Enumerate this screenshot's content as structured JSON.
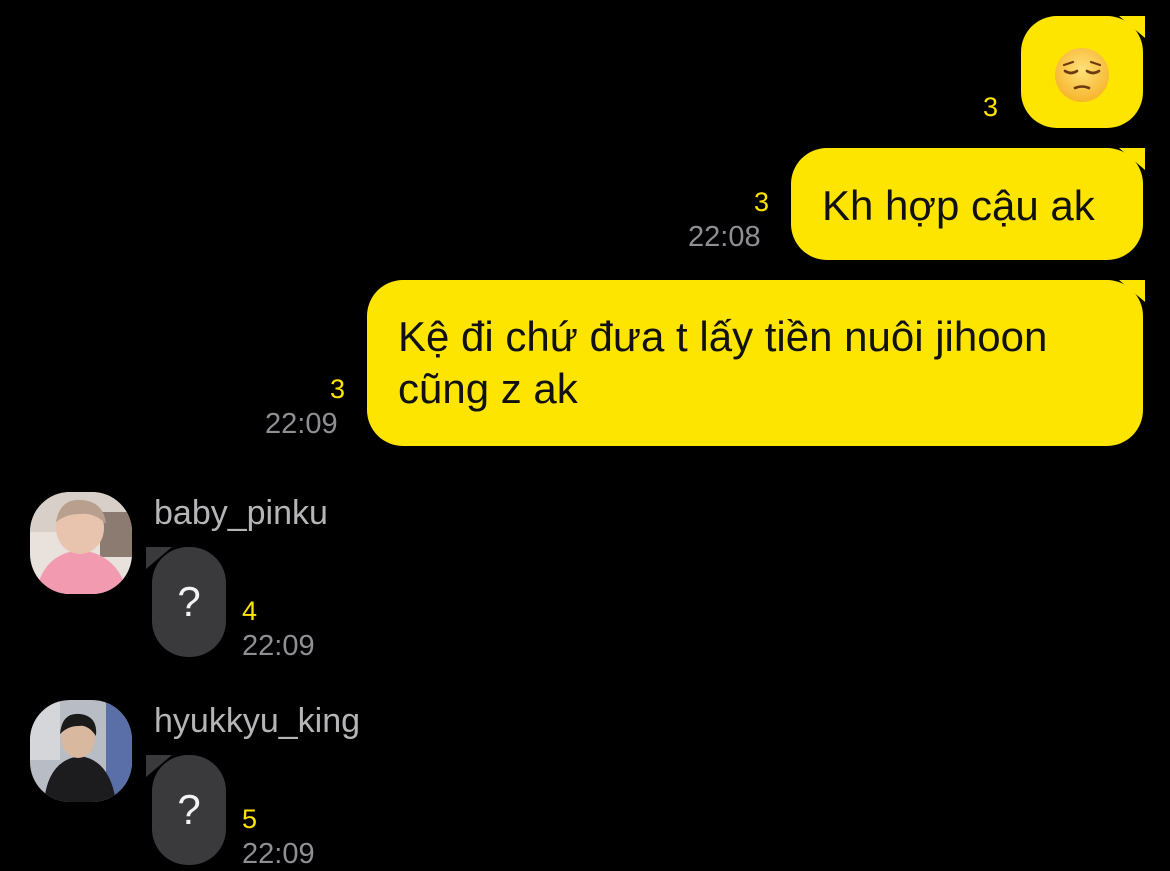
{
  "messages_out": [
    {
      "emoji": "pensive-face",
      "unread": "3"
    },
    {
      "text": "Kh hợp cậu ak",
      "unread": "3",
      "time": "22:08"
    },
    {
      "lines": [
        "Kệ đi chứ đưa t lấy tiền nuôi jihoon",
        "cũng z ak"
      ],
      "unread": "3",
      "time": "22:09"
    }
  ],
  "messages_in": [
    {
      "sender": "baby_pinku",
      "text": "?",
      "unread": "4",
      "time": "22:09"
    },
    {
      "sender": "hyukkyu_king",
      "text": "?",
      "unread": "5",
      "time": "22:09"
    }
  ],
  "colors": {
    "background": "#000000",
    "outgoing_bubble": "#FEE500",
    "incoming_bubble": "#3A3A3C",
    "unread_count": "#FEE500",
    "timestamp": "#8E8E93"
  }
}
